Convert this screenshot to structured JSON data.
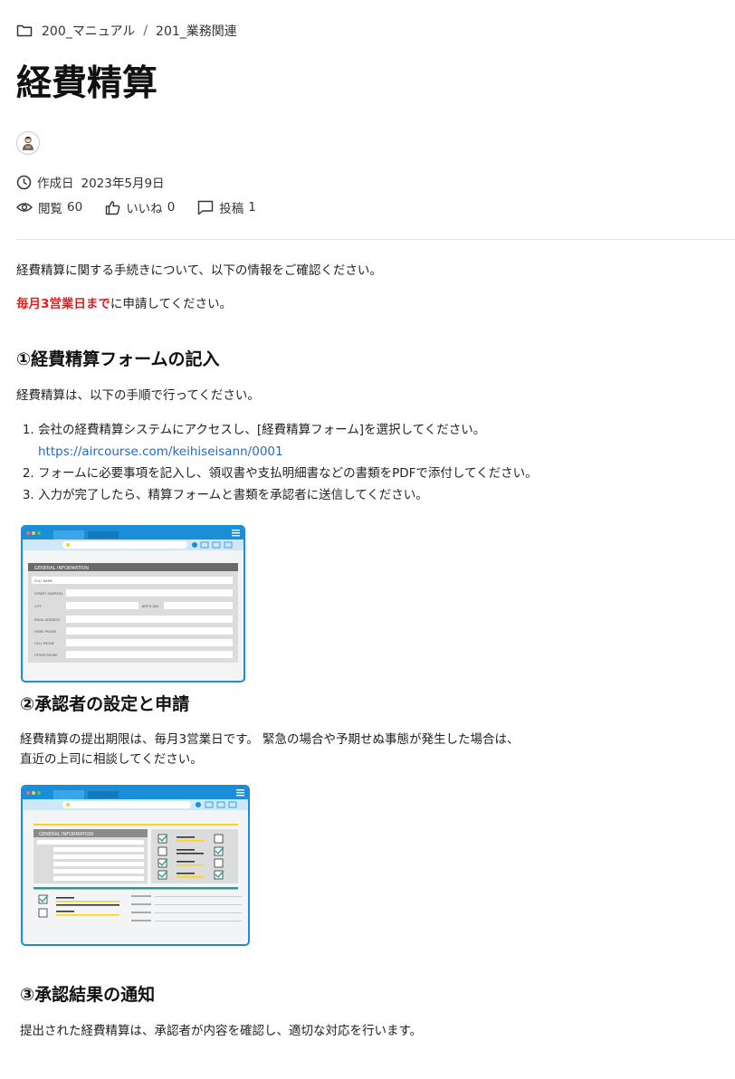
{
  "breadcrumb": {
    "items": [
      "200_マニュアル",
      "201_業務関連"
    ],
    "separator": "/"
  },
  "page": {
    "title": "経費精算"
  },
  "meta": {
    "created_label": "作成日",
    "created_date": "2023年5月9日",
    "views_label": "閲覧",
    "views_count": "60",
    "likes_label": "いいね",
    "likes_count": "0",
    "posts_label": "投稿",
    "posts_count": "1"
  },
  "intro": {
    "line1": "経費精算に関する手続きについて、以下の情報をご確認ください。",
    "deadline_emphasis": "毎月3営業日まで",
    "deadline_rest": "に申請してください。"
  },
  "section1": {
    "heading": "①経費精算フォームの記入",
    "lead": "経費精算は、以下の手順で行ってください。",
    "steps": [
      "会社の経費精算システムにアクセスし、[経費精算フォーム]を選択してください。",
      "フォームに必要事項を記入し、領収書や支払明細書などの書類をPDFで添付してください。",
      "入力が完了したら、精算フォームと書類を承認者に送信してください。"
    ],
    "link": "https://aircourse.com/keihiseisann/0001",
    "form_title": "GENERAL INFORMATION",
    "form_fields": [
      "FULL NAME",
      "STREET ADDRESS",
      "CITY",
      "BIRTH DAY",
      "EMAIL ADDRESS",
      "HOME PHONE",
      "CELL PHONE",
      "OTHER PHONE"
    ]
  },
  "section2": {
    "heading": "②承認者の設定と申請",
    "line1": "経費精算の提出期限は、毎月3営業日です。 緊急の場合や予期せぬ事態が発生した場合は、",
    "line2": "直近の上司に相談してください。",
    "form_title": "GENERAL INFORMATION"
  },
  "section3": {
    "heading": "③承認結果の通知",
    "line1": "提出された経費精算は、承認者が内容を確認し、適切な対応を行います。"
  },
  "colors": {
    "accent_red": "#e02020",
    "link_blue": "#2b67c4",
    "browser_blue": "#1a8ed6"
  }
}
